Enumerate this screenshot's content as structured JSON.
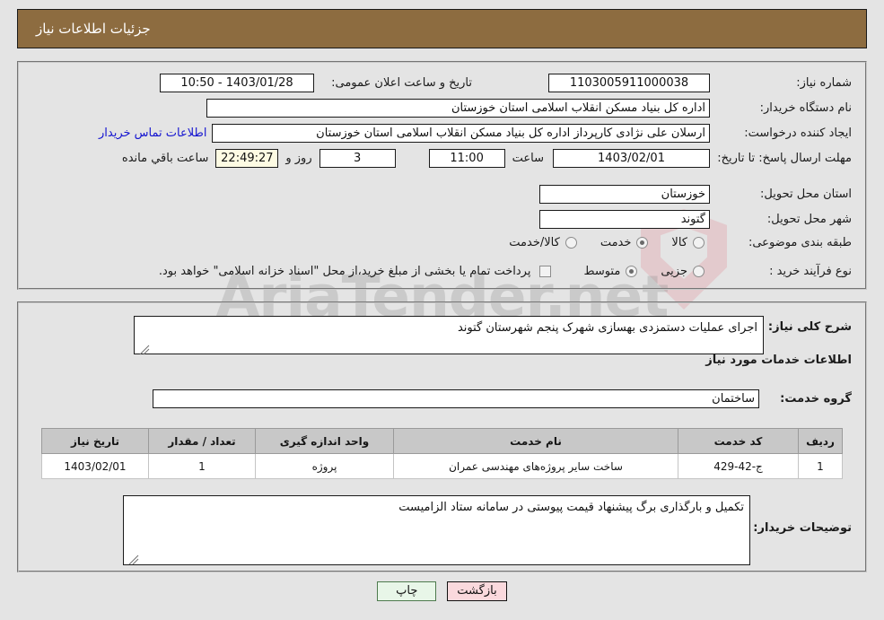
{
  "header": {
    "title": "جزئیات اطلاعات نیاز"
  },
  "form": {
    "need_number_label": "شماره نیاز:",
    "need_number_value": "1103005911000038",
    "announce_label": "تاریخ و ساعت اعلان عمومی:",
    "announce_value": "1403/01/28 - 10:50",
    "buyer_org_label": "نام دستگاه خریدار:",
    "buyer_org_value": "اداره کل بنیاد مسکن انقلاب اسلامی استان خوزستان",
    "requester_label": "ایجاد کننده درخواست:",
    "requester_value": "ارسلان علی نژادی کارپرداز اداره کل بنیاد مسکن انقلاب اسلامی استان خوزستان",
    "contact_link": "اطلاعات تماس خریدار",
    "deadline_label": "مهلت ارسال پاسخ: تا تاریخ:",
    "deadline_date": "1403/02/01",
    "hour_label": "ساعت",
    "deadline_time": "11:00",
    "days_value": "3",
    "days_label": "روز و",
    "countdown_value": "22:49:27",
    "remaining_label": "ساعت باقي مانده",
    "province_label": "استان محل تحویل:",
    "province_value": "خوزستان",
    "city_label": "شهر محل تحویل:",
    "city_value": "گتوند",
    "category_label": "طبقه بندی موضوعی:",
    "category_options": [
      {
        "label": "کالا",
        "selected": false
      },
      {
        "label": "خدمت",
        "selected": true
      },
      {
        "label": "کالا/خدمت",
        "selected": false
      }
    ],
    "process_label": "نوع فرآیند خرید :",
    "process_options": [
      {
        "label": "جزیی",
        "selected": false
      },
      {
        "label": "متوسط",
        "selected": true
      }
    ],
    "treasury_checked": false,
    "treasury_text": "پرداخت تمام یا بخشی از مبلغ خرید،از محل \"اسناد خزانه اسلامی\" خواهد بود."
  },
  "description": {
    "general_label": "شرح کلی نیاز:",
    "general_value": "اجرای عملیات دستمزدی بهسازی  شهرک پنجم شهرستان گتوند",
    "services_heading": "اطلاعات خدمات مورد نیاز",
    "service_group_label": "گروه خدمت:",
    "service_group_value": "ساختمان",
    "buyer_notes_label": "توضیحات خریدار:",
    "buyer_notes_value": "تکمیل و بارگذاری برگ پیشنهاد قیمت پیوستی در سامانه ستاد الزامیست"
  },
  "table": {
    "columns": [
      "ردیف",
      "کد خدمت",
      "نام خدمت",
      "واحد اندازه گیری",
      "تعداد / مقدار",
      "تاریخ نیاز"
    ],
    "rows": [
      {
        "row_no": "1",
        "service_code": "ج-42-429",
        "service_name": "ساخت سایر پروژه‌های مهندسی عمران",
        "unit": "پروژه",
        "quantity": "1",
        "need_date": "1403/02/01"
      }
    ]
  },
  "footer": {
    "print_label": "چاپ",
    "back_label": "بازگشت"
  },
  "watermark": {
    "text": "AriaTender.net"
  },
  "colors": {
    "header_bg": "#8d6c40",
    "page_bg": "#e4e4e4",
    "link": "#1414d0",
    "countdown_bg": "#fdfbe3",
    "print_btn_bg": "#e8f6e8",
    "back_btn_bg": "#fad9dd",
    "table_header_bg": "#c8c8c8"
  }
}
